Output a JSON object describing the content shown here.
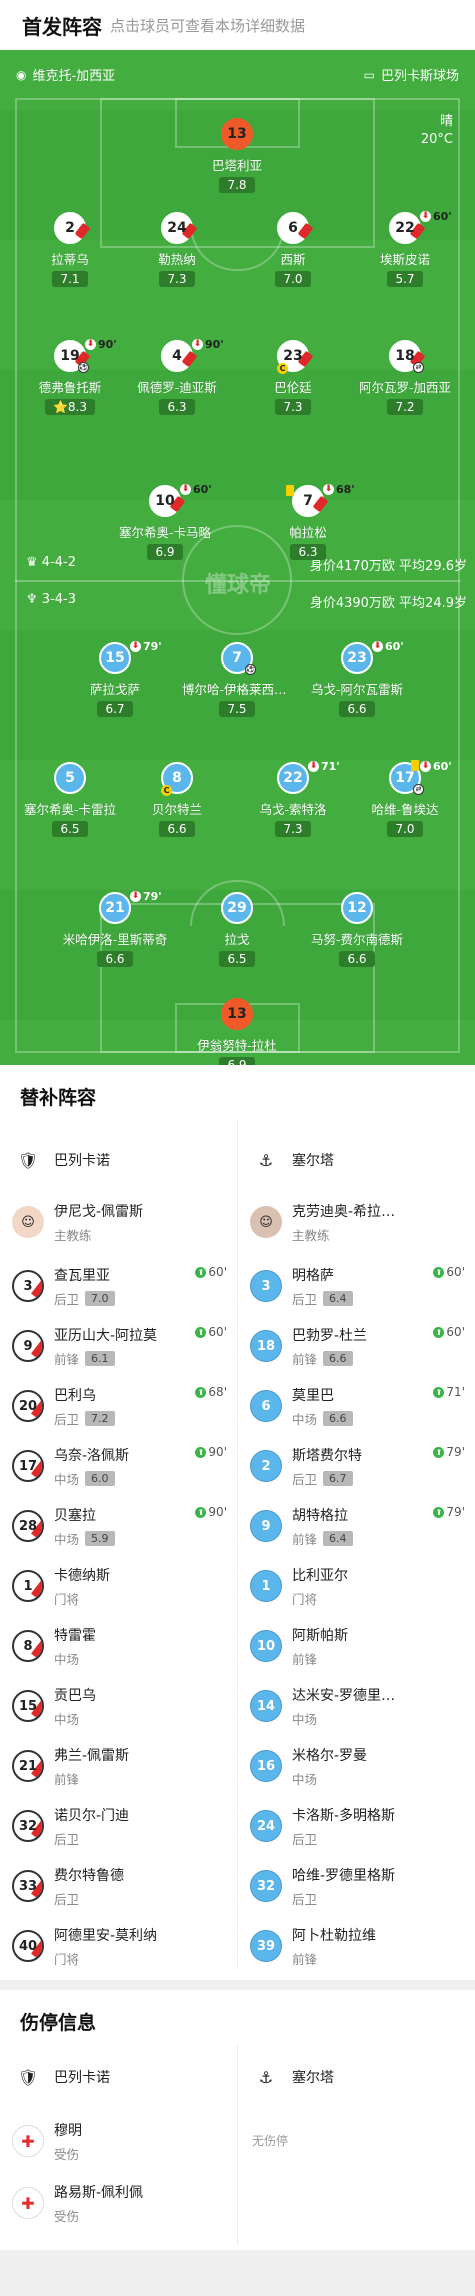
{
  "header": {
    "title": "首发阵容",
    "subtitle": "点击球员可查看本场详细数据"
  },
  "match": {
    "home_team": "维克托-加西亚",
    "away_stadium": "巴列卡斯球场",
    "weather": "晴",
    "temp": "20°C",
    "watermark": "懂球帝"
  },
  "formations": {
    "top_formation": "4-4-2",
    "top_value": "身价4170万欧",
    "top_age": "平均29.6岁",
    "bottom_formation": "3-4-3",
    "bottom_value": "身价4390万欧",
    "bottom_age": "平均24.9岁"
  },
  "home_players": [
    {
      "num": "13",
      "name": "巴塔利亚",
      "rating": "7.8",
      "kind": "k"
    },
    {
      "num": "2",
      "name": "拉蒂乌",
      "rating": "7.1",
      "kind": "r"
    },
    {
      "num": "24",
      "name": "勒热纳",
      "rating": "7.3",
      "kind": "r"
    },
    {
      "num": "6",
      "name": "西斯",
      "rating": "7.0",
      "kind": "r"
    },
    {
      "num": "22",
      "name": "埃斯皮诺",
      "rating": "5.7",
      "kind": "r",
      "sub": "60'"
    },
    {
      "num": "19",
      "name": "德弗鲁托斯",
      "rating": "8.3",
      "kind": "r",
      "sub": "90'",
      "star": "true"
    },
    {
      "num": "4",
      "name": "佩德罗-迪亚斯",
      "rating": "6.3",
      "kind": "r",
      "sub": "90'"
    },
    {
      "num": "23",
      "name": "巴伦廷",
      "rating": "7.3",
      "kind": "r"
    },
    {
      "num": "18",
      "name": "阿尔瓦罗-加西亚",
      "rating": "7.2",
      "kind": "r"
    },
    {
      "num": "10",
      "name": "塞尔希奥-卡马略",
      "rating": "6.9",
      "kind": "r",
      "sub": "60'"
    },
    {
      "num": "7",
      "name": "帕拉松",
      "rating": "6.3",
      "kind": "r",
      "sub": "68'"
    }
  ],
  "away_players": [
    {
      "num": "15",
      "name": "萨拉戈萨",
      "rating": "6.7",
      "kind": "b",
      "sub": "79'"
    },
    {
      "num": "7",
      "name": "博尔哈-伊格莱西亚斯",
      "rating": "7.5",
      "kind": "b"
    },
    {
      "num": "23",
      "name": "乌戈-阿尔瓦雷斯",
      "rating": "6.6",
      "kind": "b",
      "sub": "60'"
    },
    {
      "num": "5",
      "name": "塞尔希奥-卡雷拉",
      "rating": "6.5",
      "kind": "b"
    },
    {
      "num": "8",
      "name": "贝尔特兰",
      "rating": "6.6",
      "kind": "b"
    },
    {
      "num": "22",
      "name": "乌戈-索特洛",
      "rating": "7.3",
      "kind": "b",
      "sub": "71'"
    },
    {
      "num": "17",
      "name": "哈维-鲁埃达",
      "rating": "7.0",
      "kind": "b",
      "sub": "60'"
    },
    {
      "num": "21",
      "name": "米哈伊洛-里斯蒂奇",
      "rating": "6.6",
      "kind": "b",
      "sub": "79'"
    },
    {
      "num": "29",
      "name": "拉戈",
      "rating": "6.5",
      "kind": "b"
    },
    {
      "num": "12",
      "name": "马努-费尔南德斯",
      "rating": "6.6",
      "kind": "b"
    },
    {
      "num": "13",
      "name": "伊翁努特-拉杜",
      "rating": "6.9",
      "kind": "k"
    }
  ],
  "subs": {
    "title": "替补阵容",
    "left_team": "巴列卡诺",
    "right_team": "塞尔塔",
    "left_coach": {
      "name": "伊尼戈-佩雷斯",
      "role": "主教练"
    },
    "right_coach": {
      "name": "克劳迪奥-希拉尔德斯",
      "role": "主教练"
    },
    "left": [
      {
        "num": "3",
        "name": "查瓦里亚",
        "pos": "后卫",
        "rating": "7.0",
        "in": "60'"
      },
      {
        "num": "9",
        "name": "亚历山大-阿拉莫",
        "pos": "前锋",
        "rating": "6.1",
        "in": "60'"
      },
      {
        "num": "20",
        "name": "巴利乌",
        "pos": "后卫",
        "rating": "7.2",
        "in": "68'"
      },
      {
        "num": "17",
        "name": "乌奈-洛佩斯",
        "pos": "中场",
        "rating": "6.0",
        "in": "90'"
      },
      {
        "num": "28",
        "name": "贝塞拉",
        "pos": "中场",
        "rating": "5.9",
        "in": "90'"
      },
      {
        "num": "1",
        "name": "卡德纳斯",
        "pos": "门将"
      },
      {
        "num": "8",
        "name": "特雷霍",
        "pos": "中场"
      },
      {
        "num": "15",
        "name": "贡巴乌",
        "pos": "中场"
      },
      {
        "num": "21",
        "name": "弗兰-佩雷斯",
        "pos": "前锋"
      },
      {
        "num": "32",
        "name": "诺贝尔-门迪",
        "pos": "后卫"
      },
      {
        "num": "33",
        "name": "费尔特鲁德",
        "pos": "后卫"
      },
      {
        "num": "40",
        "name": "阿德里安-莫利纳",
        "pos": "门将"
      }
    ],
    "right": [
      {
        "num": "3",
        "name": "明格萨",
        "pos": "后卫",
        "rating": "6.4",
        "in": "60'"
      },
      {
        "num": "18",
        "name": "巴勃罗-杜兰",
        "pos": "前锋",
        "rating": "6.6",
        "in": "60'"
      },
      {
        "num": "6",
        "name": "莫里巴",
        "pos": "中场",
        "rating": "6.6",
        "in": "71'"
      },
      {
        "num": "2",
        "name": "斯塔费尔特",
        "pos": "后卫",
        "rating": "6.7",
        "in": "79'"
      },
      {
        "num": "9",
        "name": "胡特格拉",
        "pos": "前锋",
        "rating": "6.4",
        "in": "79'"
      },
      {
        "num": "1",
        "name": "比利亚尔",
        "pos": "门将"
      },
      {
        "num": "10",
        "name": "阿斯帕斯",
        "pos": "前锋"
      },
      {
        "num": "14",
        "name": "达米安-罗德里格斯",
        "pos": "中场"
      },
      {
        "num": "16",
        "name": "米格尔-罗曼",
        "pos": "中场"
      },
      {
        "num": "24",
        "name": "卡洛斯-多明格斯",
        "pos": "后卫"
      },
      {
        "num": "32",
        "name": "哈维-罗德里格斯",
        "pos": "后卫"
      },
      {
        "num": "39",
        "name": "阿卜杜勒拉维",
        "pos": "前锋"
      }
    ]
  },
  "injuries": {
    "title": "伤停信息",
    "left_team": "巴列卡诺",
    "right_team": "塞尔塔",
    "none": "无伤停",
    "left": [
      {
        "name": "穆明",
        "status": "受伤"
      },
      {
        "name": "路易斯-佩利佩",
        "status": "受伤"
      }
    ]
  }
}
